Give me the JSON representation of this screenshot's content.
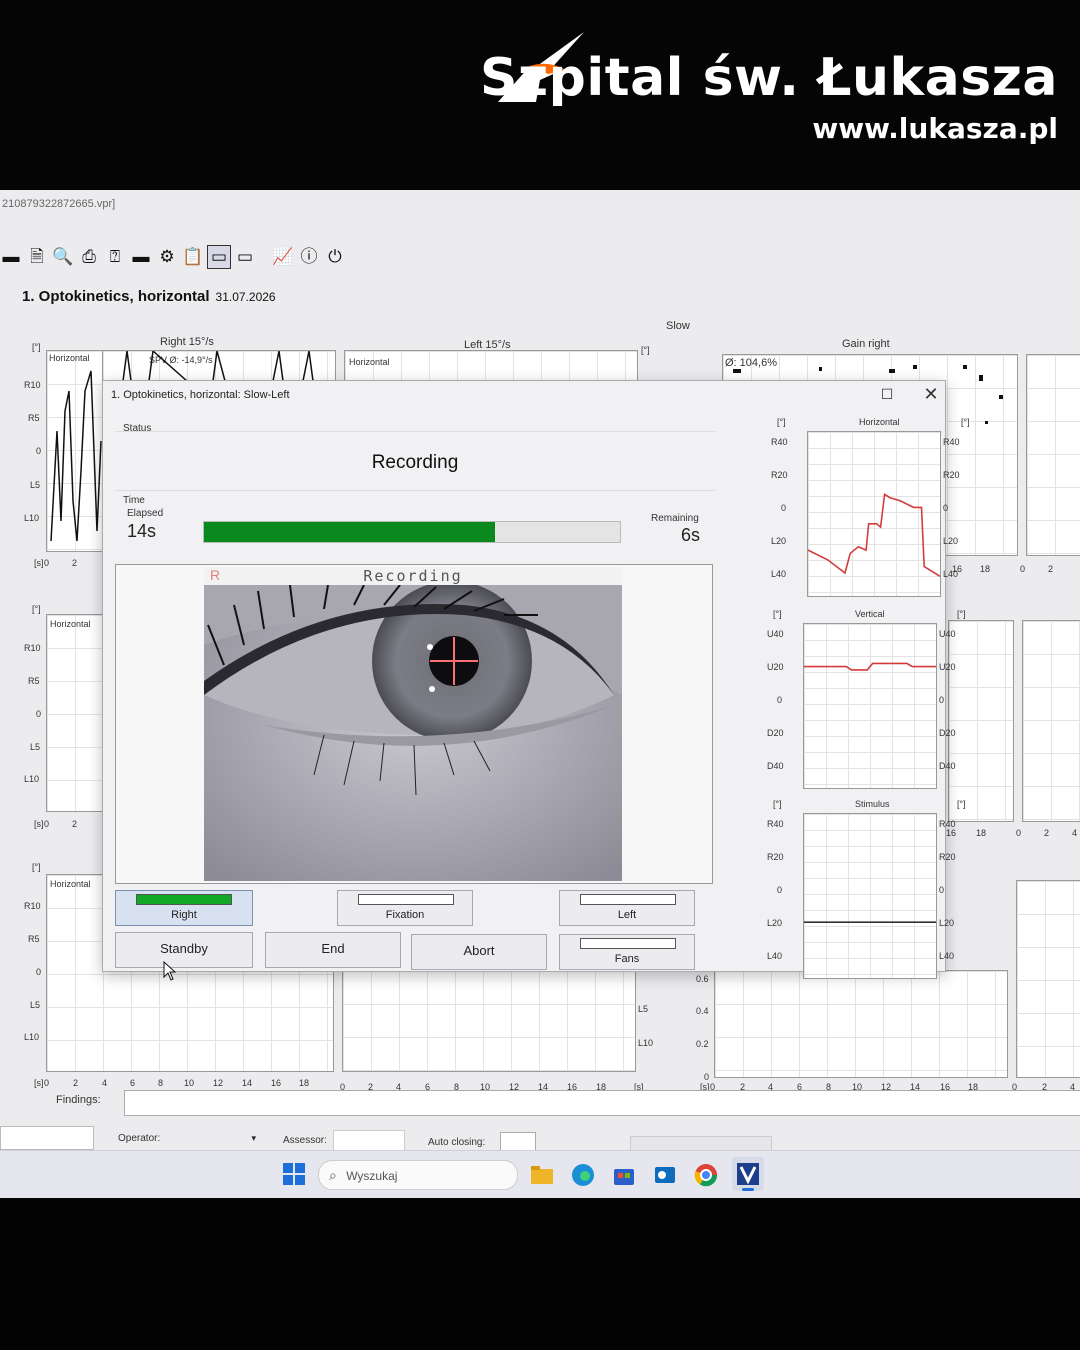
{
  "banner": {
    "brand_name": "Szpital św. Łukasza",
    "brand_url": "www.lukasza.pl",
    "accent_color": "#ff6a00"
  },
  "window": {
    "file_title": "210879322872665.vpr]"
  },
  "toolbar": {
    "icons": [
      "folder-icon",
      "new-document-icon",
      "preview-icon",
      "print-icon",
      "pdf-icon",
      "goggles-icon",
      "settings-icon",
      "clipboard-icon",
      "goggles-both-icon",
      "goggles-video-icon",
      "analysis-chart-icon",
      "info-icon",
      "power-icon"
    ]
  },
  "test": {
    "title": "1. Optokinetics, horizontal",
    "date": "31.07.2026"
  },
  "overview": {
    "right_header": "Right 15°/s",
    "left_header": "Left 15°/s",
    "slow_label": "Slow",
    "gain_right_label": "Gain right",
    "spv_label": "SPV Ø: -14,9°/s",
    "gain_value": "Ø: 104,6%",
    "horizontal_label": "Horizontal",
    "unit_deg": "[°]",
    "unit_s": "[s]",
    "y_ticks": [
      "R10",
      "R5",
      "0",
      "L5",
      "L10"
    ],
    "x_ticks": [
      "0",
      "2",
      "4",
      "6",
      "8",
      "10",
      "12",
      "14",
      "16",
      "18"
    ],
    "gain_ticks": [
      "0.6",
      "0.4",
      "0.2",
      "0"
    ],
    "side_ticks_top": [
      "16",
      "18",
      "0",
      "2"
    ],
    "side_ticks_mid": [
      "16",
      "18",
      "0",
      "2",
      "4"
    ],
    "bottom_right_ticks": [
      "0",
      "2",
      "4"
    ]
  },
  "dialog": {
    "title": "1. Optokinetics, horizontal: Slow-Left",
    "status_label": "Status",
    "status_value": "Recording",
    "time_label": "Time",
    "elapsed_label": "Elapsed",
    "elapsed_value": "14s",
    "remaining_label": "Remaining",
    "remaining_value": "6s",
    "progress_fraction": 0.7,
    "progress_color": "#0a8a1e",
    "video_eye_label": "R",
    "video_status": "Recording",
    "buttons": {
      "right": "Right",
      "fixation": "Fixation",
      "left": "Left",
      "standby": "Standby",
      "end": "End",
      "abort": "Abort",
      "fans": "Fans"
    },
    "charts": [
      {
        "title": "Horizontal",
        "unit": "[°]",
        "ticks": [
          "R40",
          "R20",
          "0",
          "L20",
          "L40"
        ]
      },
      {
        "title": "Vertical",
        "unit": "[°]",
        "ticks": [
          "U40",
          "U20",
          "0",
          "D20",
          "D40"
        ]
      },
      {
        "title": "Stimulus",
        "unit": "[°]",
        "ticks": [
          "R40",
          "R20",
          "0",
          "L20",
          "L40"
        ]
      }
    ]
  },
  "footer": {
    "findings_label": "Findings:",
    "operator_label": "Operator:",
    "assessor_label": "Assessor:",
    "auto_closing_label": "Auto closing:"
  },
  "taskbar": {
    "search_placeholder": "Wyszukaj"
  }
}
